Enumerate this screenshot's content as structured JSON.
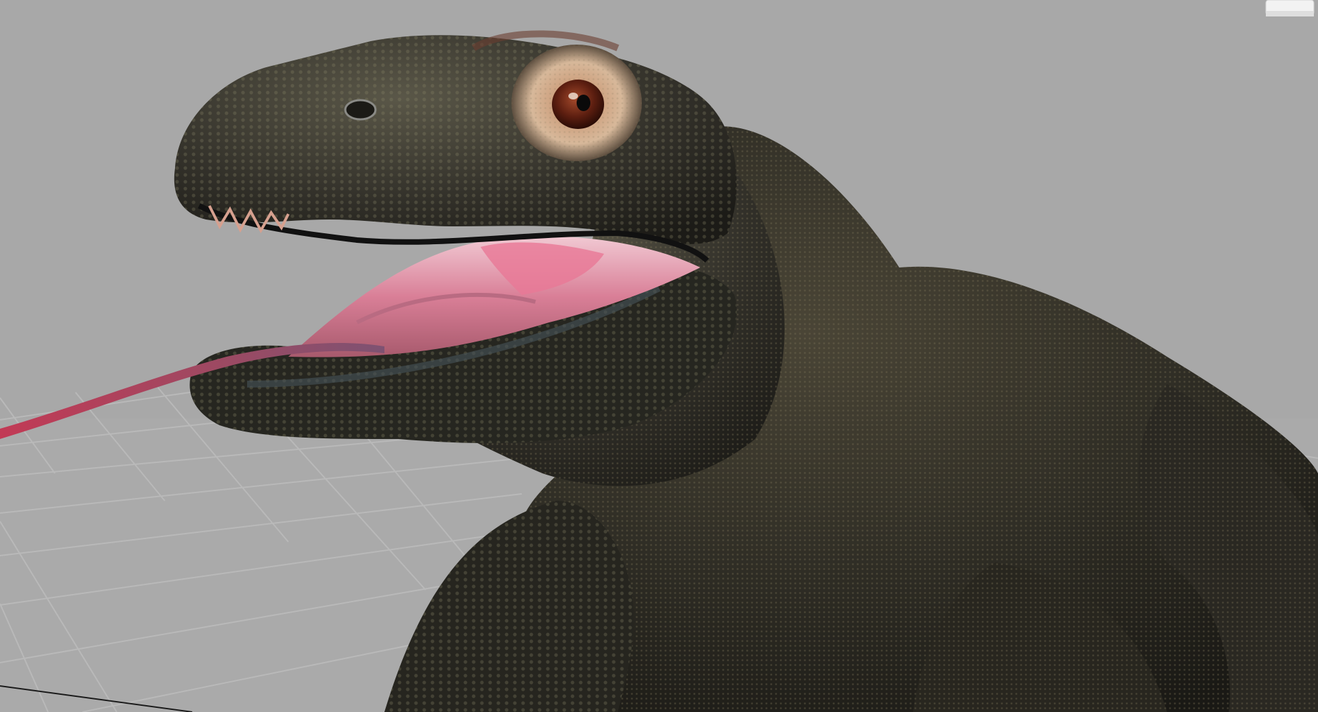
{
  "viewport": {
    "background_color": "#a8a8a8",
    "grid_line_color": "#b4b4b4",
    "grid_floor_color": "#b3b3b3"
  },
  "view_cube": {
    "icon": "view-cube-icon"
  },
  "model": {
    "subject": "komodo-dragon",
    "skin_color": "#2b2a24",
    "skin_highlight_color": "#6a6248",
    "mouth_color": "#d98a9c",
    "tongue_color": "#b8485e",
    "eye_color": "#7a2e1a"
  }
}
